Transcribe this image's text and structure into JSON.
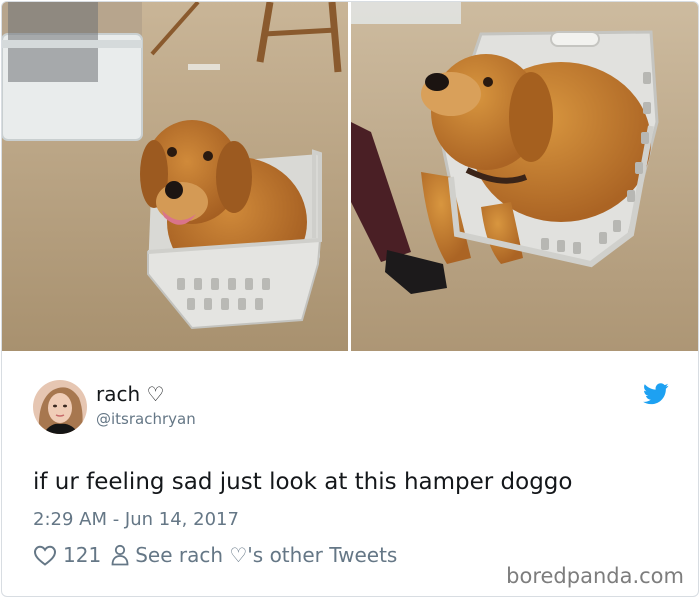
{
  "tweet": {
    "display_name": "rach ♡",
    "handle": "@itsrachryan",
    "text": "if ur feeling sad just look at this hamper doggo",
    "timestamp": "2:29 AM - Jun 14, 2017",
    "like_count": "121",
    "other_tweets_link": "See rach ♡'s other Tweets"
  },
  "icons": {
    "brand": "twitter-bird-icon",
    "like": "heart-outline-icon",
    "profile": "person-outline-icon"
  },
  "watermark": "boredpanda.com",
  "colors": {
    "twitter_blue": "#1da1f2",
    "text_primary": "#14171a",
    "text_secondary": "#657786",
    "carpet": "#b8a288",
    "dog_fur": "#c37a32",
    "hamper": "#e3e3e0"
  }
}
